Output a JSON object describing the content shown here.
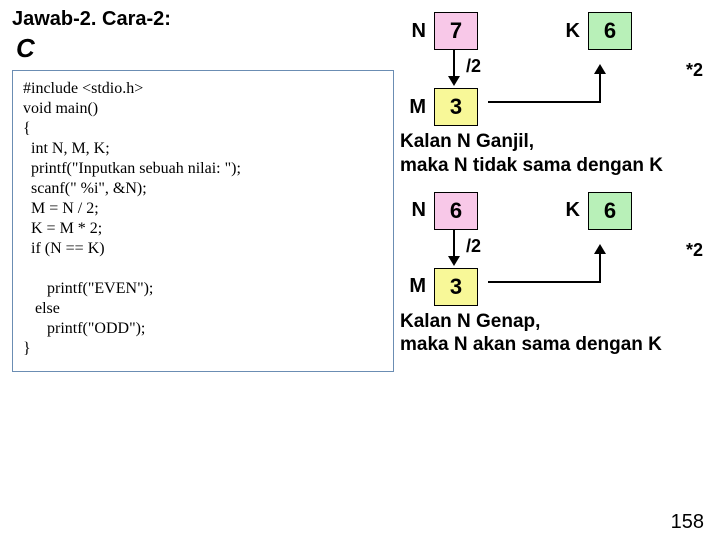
{
  "header": {
    "title": "Jawab-2. Cara-2:",
    "lang": "C"
  },
  "code": {
    "line1": "#include <stdio.h>",
    "line2": "void main()",
    "line3": "{",
    "line4": "  int N, M, K;",
    "line5": "  printf(\"Inputkan sebuah nilai: \");",
    "line6": "  scanf(\" %i\", &N);",
    "line7": "  M = N / 2;",
    "line8": "  K = M * 2;",
    "line9": "  if (N == K)",
    "line10": " ",
    "line11": "      printf(\"EVEN\");",
    "line12": "   else",
    "line13": "      printf(\"ODD\");",
    "line14": "}"
  },
  "diagram1": {
    "N_label": "N",
    "N_val": "7",
    "K_label": "K",
    "K_val": "6",
    "op_div": "/2",
    "op_mul": "*2",
    "M_label": "M",
    "M_val": "3",
    "text1": "Kalan N Ganjil,",
    "text2": "maka N tidak sama dengan K"
  },
  "diagram2": {
    "N_label": "N",
    "N_val": "6",
    "K_label": "K",
    "K_val": "6",
    "op_div": "/2",
    "op_mul": "*2",
    "M_label": "M",
    "M_val": "3",
    "text1": "Kalan N Genap,",
    "text2": "maka N akan sama dengan K"
  },
  "page_number": "158"
}
